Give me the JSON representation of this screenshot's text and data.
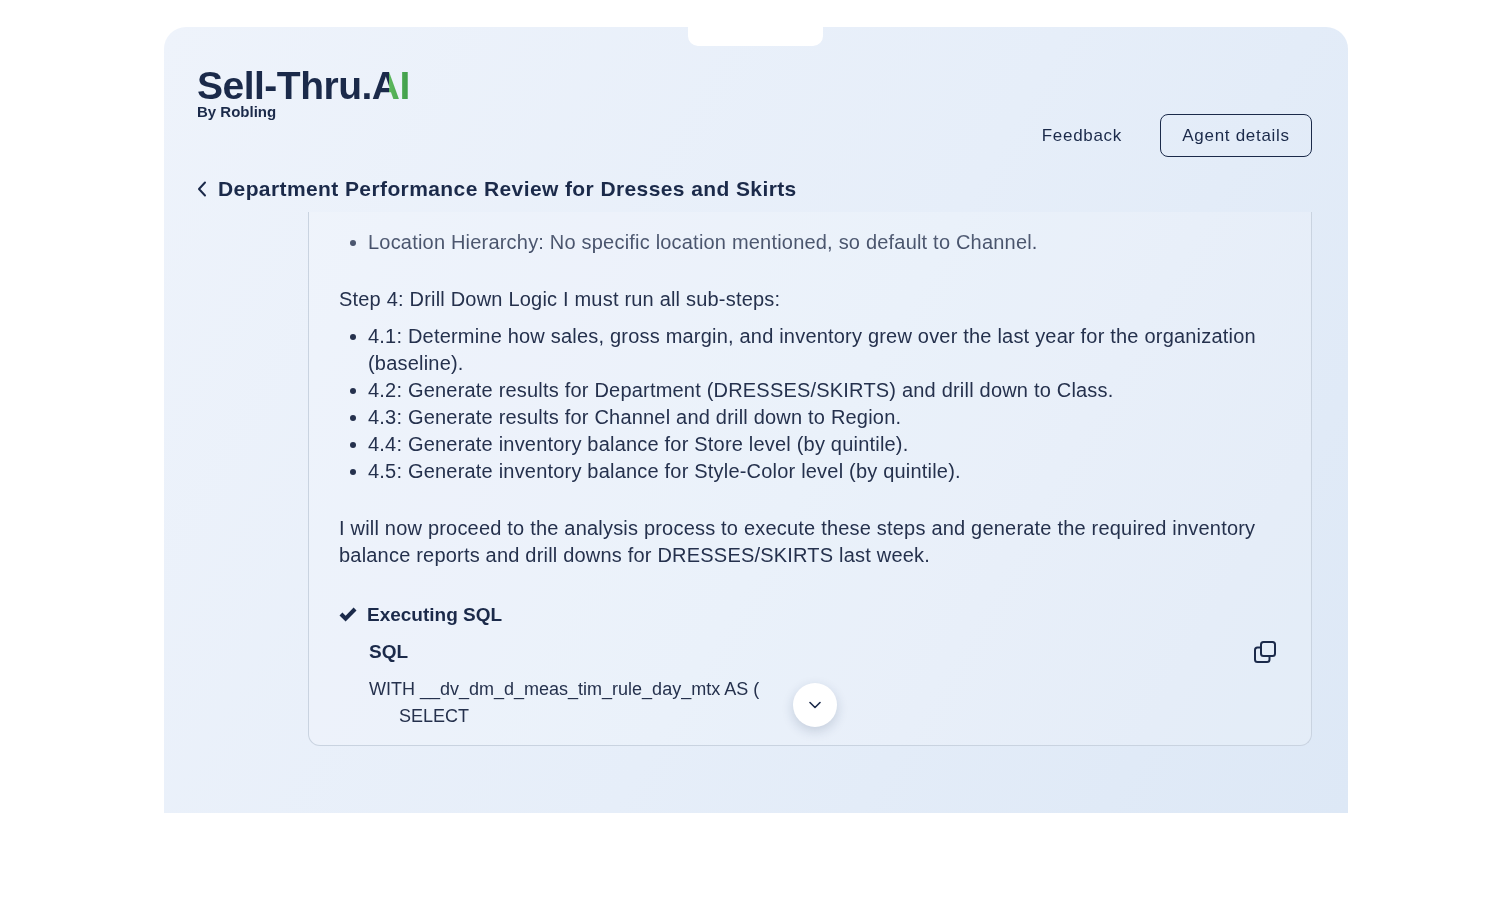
{
  "header": {
    "logo": {
      "wordmark": "Sell-Thru.AI",
      "byline": "By Robling"
    },
    "actions": [
      {
        "kind": "link",
        "label": "Feedback"
      },
      {
        "kind": "outlined",
        "label": "Agent details"
      }
    ]
  },
  "conversation": {
    "title": "Department Performance Review for Dresses and Skirts",
    "blocks": [
      {
        "kind": "bullets",
        "items": [
          "Location Hierarchy: No specific location mentioned, so default to Channel."
        ]
      },
      {
        "kind": "paragraph",
        "text": "Step 4: Drill Down Logic I must run all sub-steps:"
      },
      {
        "kind": "bullets",
        "items": [
          "4.1: Determine how sales, gross margin, and inventory grew over the last year for the organization (baseline).",
          "4.2: Generate results for Department (DRESSES/SKIRTS) and drill down to Class.",
          "4.3: Generate results for Channel and drill down to Region.",
          "4.4: Generate inventory balance for Store level (by quintile).",
          "4.5: Generate inventory balance for Style-Color level (by quintile)."
        ]
      },
      {
        "kind": "paragraph",
        "text": "I will now proceed to the analysis process to execute these steps and generate the required inventory balance reports and drill downs for DRESSES/SKIRTS last week."
      },
      {
        "kind": "tool_step",
        "done": true,
        "label": "Executing SQL",
        "code_title": "SQL",
        "code": "WITH __dv_dm_d_meas_tim_rule_day_mtx AS (\n      SELECT"
      }
    ]
  }
}
